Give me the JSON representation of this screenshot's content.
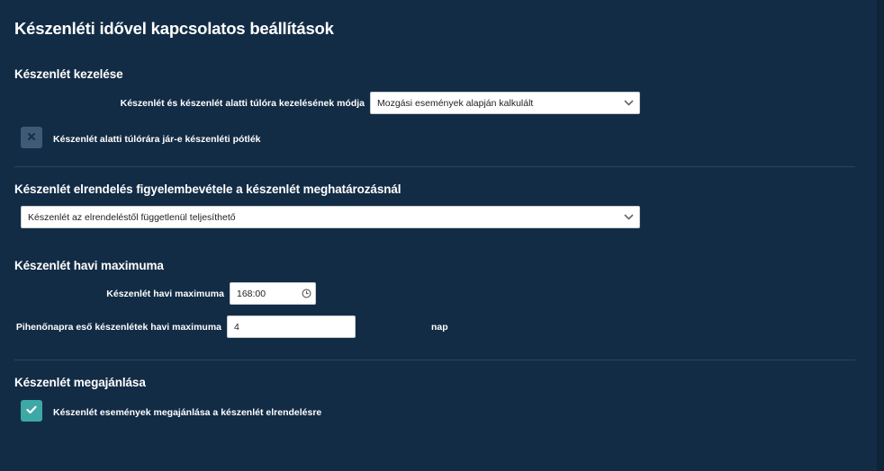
{
  "page": {
    "title": "Készenléti idővel kapcsolatos beállítások"
  },
  "sections": {
    "handling": {
      "title": "Készenlét kezelése",
      "mode_label": "Készenlét és készenlét alatti túlóra kezelésének módja",
      "mode_value": "Mozgási események alapján kalkulált",
      "supplement_label": "Készenlét alatti túlórára jár-e készenléti pótlék",
      "supplement_checked": false
    },
    "order": {
      "title": "Készenlét elrendelés figyelembevétele a készenlét meghatározásnál",
      "value": "Készenlét az elrendeléstől függetlenül teljesíthető"
    },
    "monthly_max": {
      "title": "Készenlét havi maximuma",
      "max_label": "Készenlét havi maximuma",
      "max_value": "168:00",
      "rest_label": "Pihenőnapra eső készenlétek havi maximuma",
      "rest_value": "4",
      "rest_unit": "nap"
    },
    "offer": {
      "title": "Készenlét megajánlása",
      "offer_label": "Készenlét események megajánlása a készenlét elrendelésre",
      "offer_checked": true
    }
  },
  "colors": {
    "background": "#132c45",
    "checkbox_on": "#3da8a6",
    "checkbox_off": "#3f5a74"
  },
  "icons": {
    "dropdown": "chevron-down-icon",
    "clock": "clock-icon",
    "unchecked": "close-icon",
    "checked": "check-icon"
  }
}
